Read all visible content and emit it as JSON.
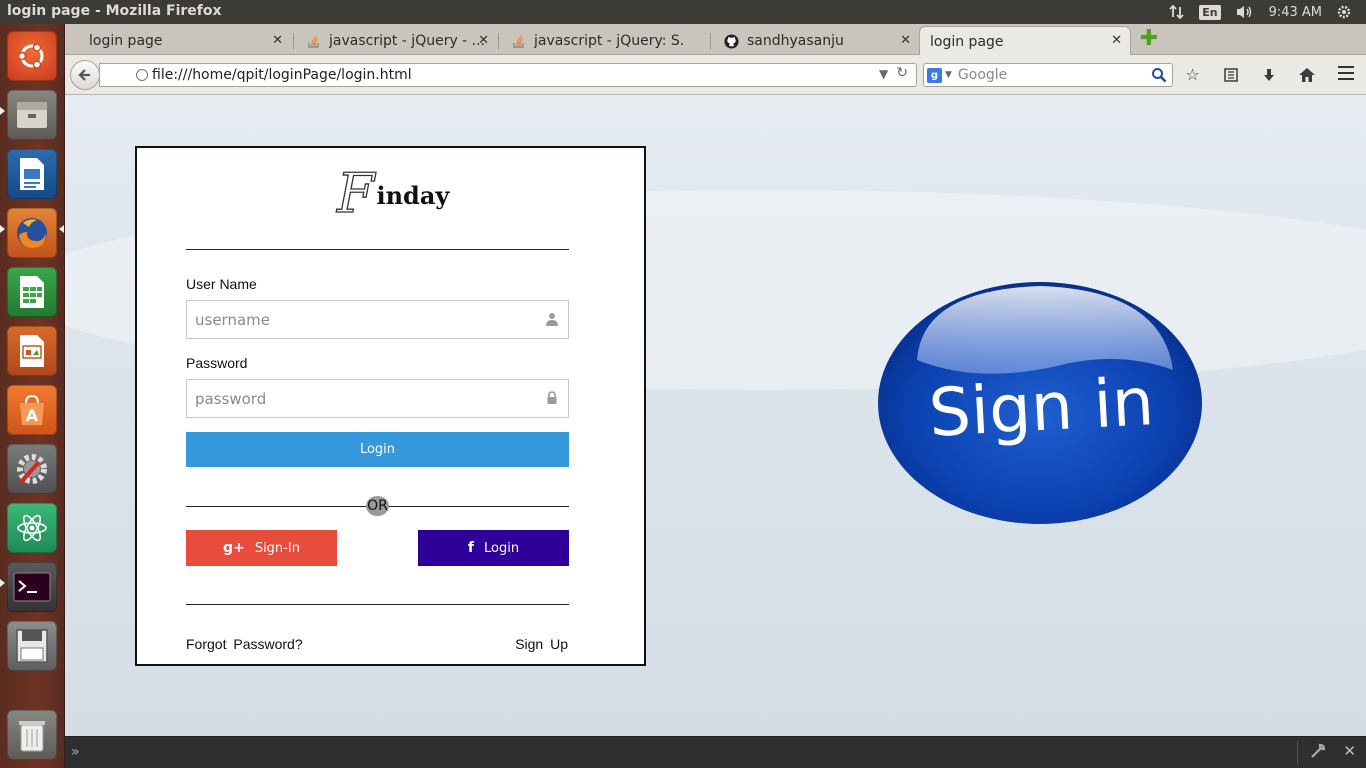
{
  "window": {
    "title": "login page - Mozilla Firefox"
  },
  "tray": {
    "keyboard": "En",
    "time": "9:43 AM"
  },
  "launcher": {
    "items": [
      {
        "name": "ubuntu-dash-icon"
      },
      {
        "name": "files-icon"
      },
      {
        "name": "writer-icon"
      },
      {
        "name": "firefox-icon"
      },
      {
        "name": "calc-icon"
      },
      {
        "name": "impress-icon"
      },
      {
        "name": "software-center-icon"
      },
      {
        "name": "system-settings-icon"
      },
      {
        "name": "atom-icon"
      },
      {
        "name": "terminal-icon"
      },
      {
        "name": "save-disk-icon"
      },
      {
        "name": "trash-icon"
      }
    ]
  },
  "tabs": [
    {
      "label": "login page"
    },
    {
      "label": "javascript - jQuery - ..."
    },
    {
      "label": "javascript - jQuery: S..."
    },
    {
      "label": "sandhyasanju"
    },
    {
      "label": "login page"
    }
  ],
  "navbar": {
    "url": "file:///home/qpit/loginPage/login.html",
    "search_placeholder": "Google",
    "search_engine_badge": "g"
  },
  "login_card": {
    "logo_initial": "F",
    "logo_rest": "inday",
    "username_label": "User Name",
    "username_placeholder": "username",
    "password_label": "Password",
    "password_placeholder": "password",
    "login_button": "Login",
    "or_text": "OR",
    "google_button": "Sign-In",
    "google_icon": "g+",
    "facebook_button": "Login",
    "facebook_icon": "f",
    "forgot_link": "Forgot Password?",
    "signup_link": "Sign Up"
  },
  "side_image": {
    "text": "Sign in"
  },
  "colors": {
    "login_button": "#3498db",
    "google_button": "#e74c3c",
    "facebook_button": "#2e0099",
    "sign_in_badge": "#0a3ea8"
  }
}
